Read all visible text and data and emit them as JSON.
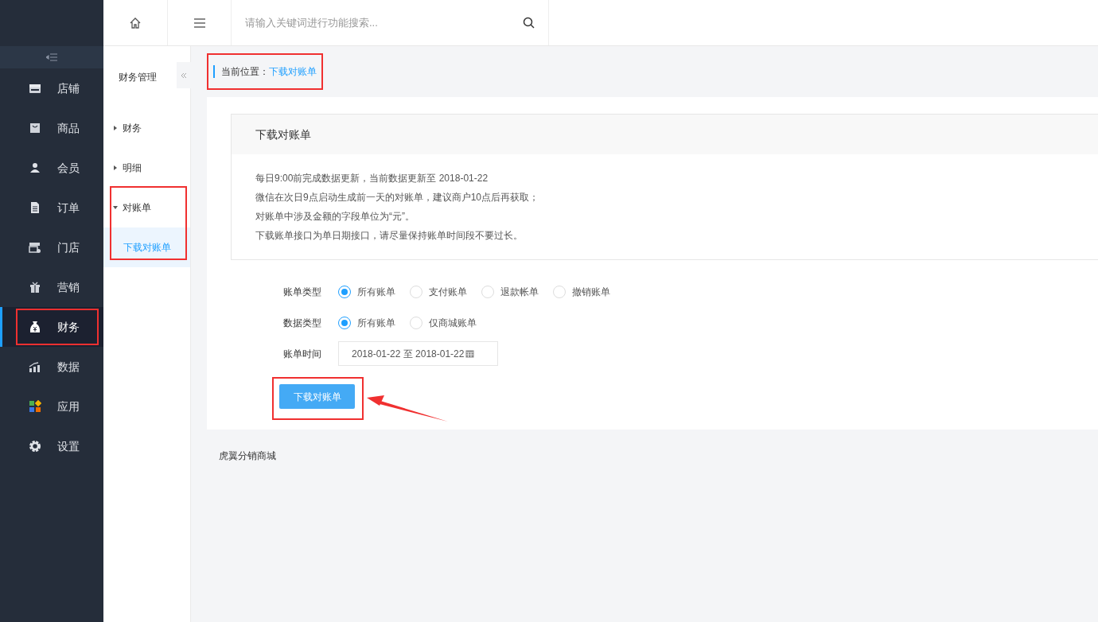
{
  "search": {
    "placeholder": "请输入关键词进行功能搜索..."
  },
  "sidebar": {
    "items": [
      {
        "kind": "store",
        "label": "店铺",
        "selected": false,
        "highlighted": false
      },
      {
        "kind": "bag",
        "label": "商品",
        "selected": false,
        "highlighted": false
      },
      {
        "kind": "user",
        "label": "会员",
        "selected": false,
        "highlighted": false
      },
      {
        "kind": "doc",
        "label": "订单",
        "selected": false,
        "highlighted": false
      },
      {
        "kind": "shop",
        "label": "门店",
        "selected": false,
        "highlighted": false
      },
      {
        "kind": "gift",
        "label": "营销",
        "selected": false,
        "highlighted": false
      },
      {
        "kind": "money",
        "label": "财务",
        "selected": true,
        "highlighted": true
      },
      {
        "kind": "chart",
        "label": "数据",
        "selected": false,
        "highlighted": false
      },
      {
        "kind": "apps",
        "label": "应用",
        "selected": false,
        "highlighted": false
      },
      {
        "kind": "gear",
        "label": "设置",
        "selected": false,
        "highlighted": false
      }
    ]
  },
  "submenu": {
    "title": "财务管理",
    "groups": [
      {
        "label": "财务",
        "expanded": false,
        "highlighted": false
      },
      {
        "label": "明细",
        "expanded": false,
        "highlighted": false
      },
      {
        "label": "对账单",
        "expanded": true,
        "highlighted": true,
        "children": [
          {
            "label": "下载对账单",
            "selected": true
          }
        ]
      }
    ]
  },
  "breadcrumb": {
    "label": "当前位置：",
    "current": "下载对账单",
    "highlighted": true
  },
  "notice": {
    "title": "下载对账单",
    "lines": [
      "每日9:00前完成数据更新，当前数据更新至 2018-01-22",
      "微信在次日9点启动生成前一天的对账单，建议商户10点后再获取；",
      "对账单中涉及金额的字段单位为“元”。",
      "下载账单接口为单日期接口，请尽量保持账单时间段不要过长。"
    ]
  },
  "form": {
    "bill_type": {
      "label": "账单类型",
      "options": [
        {
          "label": "所有账单",
          "selected": true
        },
        {
          "label": "支付账单",
          "selected": false
        },
        {
          "label": "退款帐单",
          "selected": false
        },
        {
          "label": "撤销账单",
          "selected": false
        }
      ]
    },
    "data_type": {
      "label": "数据类型",
      "options": [
        {
          "label": "所有账单",
          "selected": true
        },
        {
          "label": "仅商城账单",
          "selected": false
        }
      ]
    },
    "bill_time": {
      "label": "账单时间",
      "value": "2018-01-22 至 2018-01-22"
    },
    "download_button": {
      "label": "下载对账单",
      "highlighted": true,
      "arrow": true
    }
  },
  "footer": "虎翼分销商城"
}
